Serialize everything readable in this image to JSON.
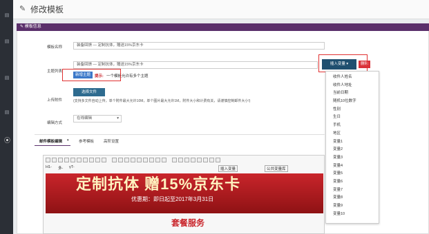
{
  "page": {
    "title": "修改模板"
  },
  "panel": {
    "title": "模板信息"
  },
  "form": {
    "name_label": "模板名称",
    "name_value": "装备回馈 — 定制抗体，赠送15%京东卡",
    "subject_label": "主题列表",
    "subject_value": "装备回馈 — 定制抗体，赠送15%京东卡",
    "add_subject_btn": "新增主题",
    "hint_prefix": "提示:",
    "hint_text": "一个模板允许有多个主题",
    "insert_var_btn": "插入变量",
    "delete_btn": "删除",
    "attach_label": "上传附件",
    "select_file_btn": "选择文件",
    "attach_note": "(支持多文件自动上传，单个附件最大允许10M，单个图片最大允许1M，附件大小和计费有关，请谨慎控制邮件大小!)",
    "edit_mode_label": "编辑方式",
    "edit_mode_value": "在线编辑"
  },
  "variables": [
    "收件人姓名",
    "收件人地址",
    "当前日期",
    "随机10位数字",
    "性别",
    "生日",
    "手机",
    "地区",
    "变量1",
    "变量2",
    "变量3",
    "变量4",
    "变量5",
    "变量6",
    "变量7",
    "变量8",
    "变量9",
    "变量10"
  ],
  "tabs": [
    "邮件模板编辑",
    "参考模板",
    "高阶设置"
  ],
  "toolbar": {
    "heading": "H1-",
    "font": "多-",
    "size": "γT-",
    "insert_var": "插入变量",
    "private_var": "公共变量库"
  },
  "banner": {
    "headline": "定制抗体  赠15%京东卡",
    "sub": "优惠期：即日起至2017年3月31日",
    "section": "套餐服务"
  }
}
